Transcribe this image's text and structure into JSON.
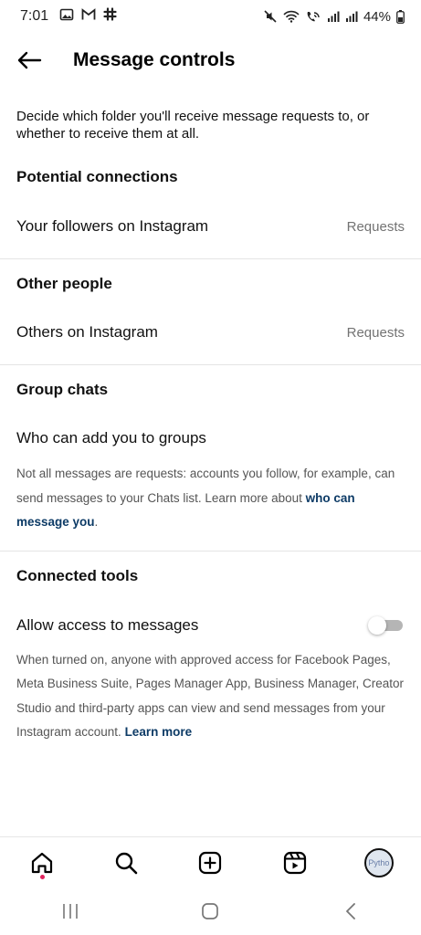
{
  "status_bar": {
    "time": "7:01",
    "battery": "44%"
  },
  "header": {
    "title": "Message controls"
  },
  "intro": "Decide which folder you'll receive message requests to, or whether to receive them at all.",
  "sections": {
    "potential": {
      "title": "Potential connections",
      "row_label": "Your followers on Instagram",
      "row_value": "Requests"
    },
    "other": {
      "title": "Other people",
      "row_label": "Others on Instagram",
      "row_value": "Requests"
    },
    "groups": {
      "title": "Group chats",
      "row_label": "Who can add you to groups",
      "note_prefix": "Not all messages are requests: accounts you follow, for example, can send messages to your Chats list. Learn more about ",
      "note_link": "who can message you",
      "note_suffix": "."
    },
    "tools": {
      "title": "Connected tools",
      "row_label": "Allow access to messages",
      "toggle_on": false,
      "note_prefix": "When turned on, anyone with approved access for Facebook Pages, Meta Business Suite, Pages Manager App, Business Manager, Creator Studio and third-party apps can view and send messages from your Instagram account. ",
      "note_link": "Learn more"
    }
  },
  "bottom_nav": {
    "items": [
      "home-icon",
      "search-icon",
      "create-icon",
      "reels-icon",
      "profile-avatar"
    ],
    "avatar_text": "Pytho"
  },
  "system_nav": [
    "recents-icon",
    "home-button-icon",
    "back-nav-icon"
  ],
  "colors": {
    "link": "#0d3b66",
    "notification_dot": "#e0245e",
    "toggle_off": "#b5b5b5"
  }
}
